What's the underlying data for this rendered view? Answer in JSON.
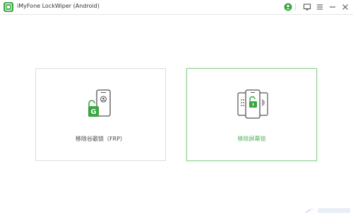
{
  "window": {
    "title": "iMyFone LockWiper (Android)",
    "controls": [
      "account-icon",
      "feedback-icon",
      "menu-icon",
      "minimize-icon",
      "close-icon"
    ]
  },
  "options": [
    {
      "label": "移除谷歌锁（FRP）",
      "icon": "frp-phone-unlock-icon",
      "selected": false
    },
    {
      "label": "移除屏幕锁",
      "icon": "screen-lock-phones-icon",
      "selected": true
    }
  ],
  "colors": {
    "accent": "#3aa640",
    "selected_text": "#4fb357",
    "selected_border": "#8fcf94",
    "card_border": "#dcdcdc"
  }
}
